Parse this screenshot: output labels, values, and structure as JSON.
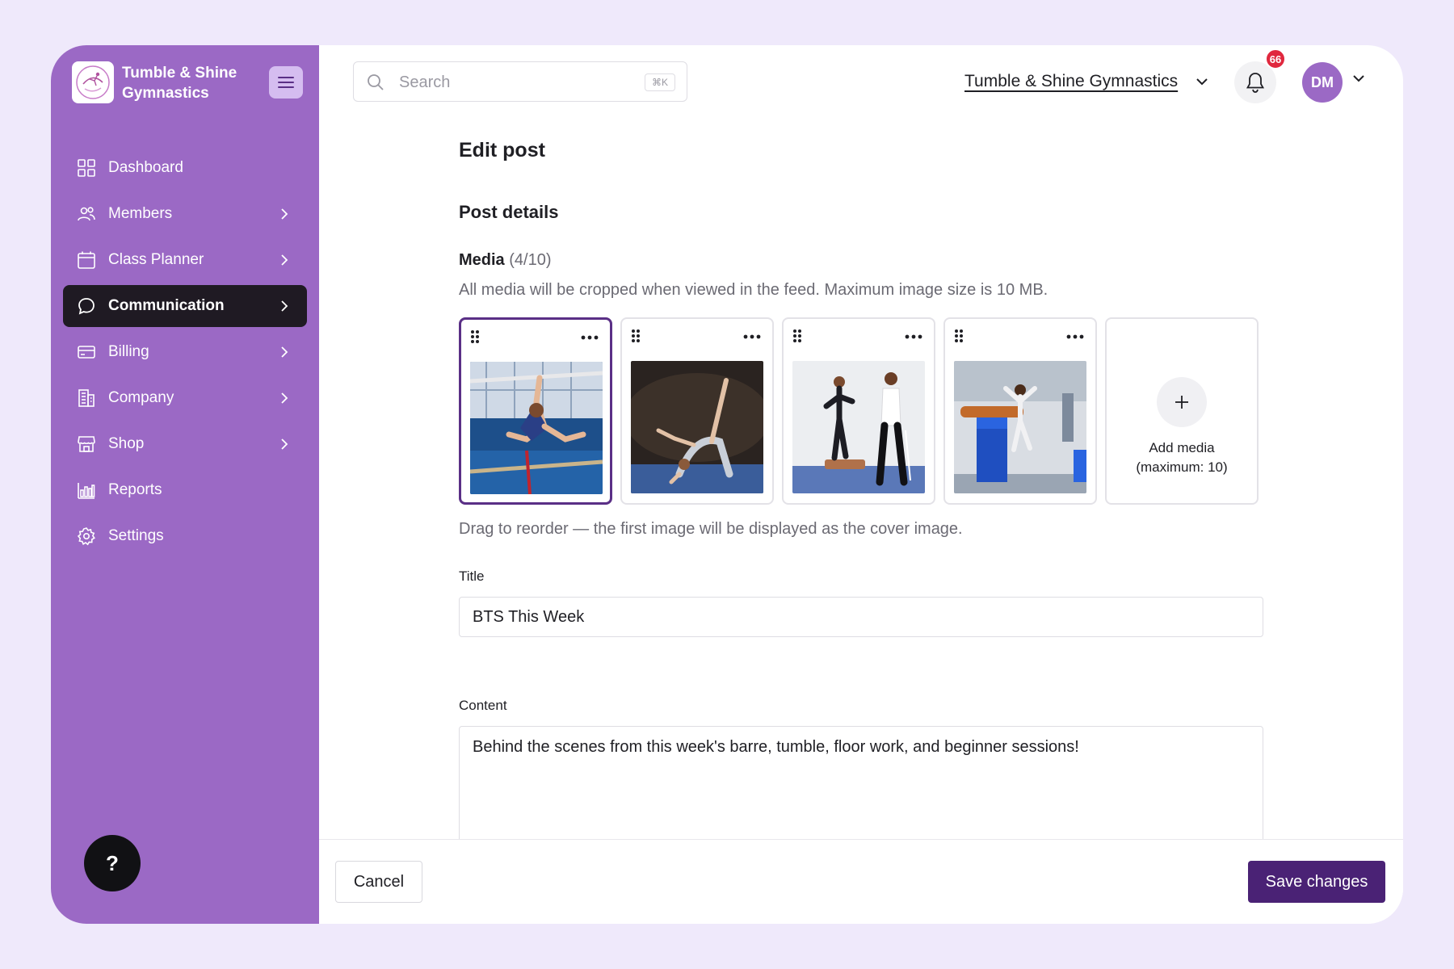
{
  "brand": {
    "name": "Tumble & Shine Gymnastics",
    "logo_text": "Tumble & Shine"
  },
  "sidebar": {
    "items": [
      {
        "label": "Dashboard",
        "icon": "dashboard-grid-icon",
        "has_children": false
      },
      {
        "label": "Members",
        "icon": "members-icon",
        "has_children": true
      },
      {
        "label": "Class Planner",
        "icon": "calendar-icon",
        "has_children": true
      },
      {
        "label": "Communication",
        "icon": "chat-bubble-icon",
        "has_children": true,
        "active": true
      },
      {
        "label": "Billing",
        "icon": "credit-card-icon",
        "has_children": true
      },
      {
        "label": "Company",
        "icon": "building-icon",
        "has_children": true
      },
      {
        "label": "Shop",
        "icon": "storefront-icon",
        "has_children": true
      },
      {
        "label": "Reports",
        "icon": "bar-chart-icon",
        "has_children": false
      },
      {
        "label": "Settings",
        "icon": "gear-icon",
        "has_children": false
      }
    ],
    "help_label": "?"
  },
  "topbar": {
    "search_placeholder": "Search",
    "search_shortcut": "⌘K",
    "org_name": "Tumble & Shine Gymnastics",
    "notification_count": "66",
    "avatar_initials": "DM"
  },
  "page": {
    "title": "Edit post",
    "section_title": "Post details",
    "media": {
      "label": "Media",
      "count": "(4/10)",
      "help": "All media will be cropped when viewed in the feed. Maximum image size is 10 MB.",
      "items": [
        {
          "subject": "gymnast on uneven bars",
          "cover": true
        },
        {
          "subject": "gymnast performing backbend kick on floor",
          "cover": false
        },
        {
          "subject": "gymnast on beam with coach",
          "cover": false
        },
        {
          "subject": "gymnast landing vault",
          "cover": false
        }
      ],
      "add_label": "Add media",
      "add_sub": "(maximum: 10)",
      "reorder_help": "Drag to reorder — the first image will be displayed as the cover image."
    },
    "title_field": {
      "label": "Title",
      "value": "BTS This Week"
    },
    "content_field": {
      "label": "Content",
      "value": "Behind the scenes from this week's barre, tumble, floor work, and beginner sessions!"
    }
  },
  "footer": {
    "cancel_label": "Cancel",
    "save_label": "Save changes"
  },
  "colors": {
    "sidebar_bg": "#9b69c5",
    "active_nav_bg": "#1f1a23",
    "primary_button": "#4a2275",
    "badge": "#e0283e",
    "page_bg": "#efe9fb"
  }
}
